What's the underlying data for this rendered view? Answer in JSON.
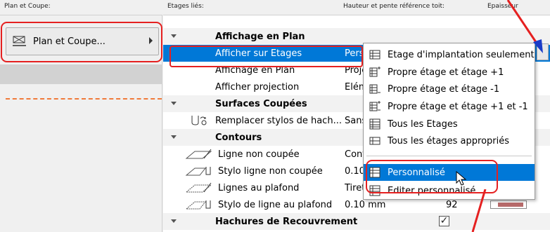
{
  "headers": {
    "plan_coupe": "Plan et Coupe:",
    "etages_lies": "Etages liés:",
    "hauteur": "Hauteur et pente référence toit:",
    "epaisseur": "Epaisseur"
  },
  "left": {
    "button_label": "Plan et Coupe..."
  },
  "rows": [
    {
      "type": "group",
      "name": "Affichage en Plan"
    },
    {
      "type": "sel",
      "name": "Afficher sur Etages",
      "value": "Perso"
    },
    {
      "type": "item",
      "name": "Affichage en Plan",
      "value": "Proje"
    },
    {
      "type": "item",
      "name": "Afficher projection",
      "value": "Elém"
    },
    {
      "type": "group",
      "name": "Surfaces Coupées"
    },
    {
      "type": "item",
      "name": "Remplacer stylos de hach...",
      "value": "Sans"
    },
    {
      "type": "group",
      "name": "Contours"
    },
    {
      "type": "item",
      "name": "Ligne non coupée",
      "value": "Cont"
    },
    {
      "type": "item",
      "name": "Stylo ligne non coupée",
      "value": "0.10"
    },
    {
      "type": "item",
      "name": "Lignes au plafond",
      "value": "Tireté"
    },
    {
      "type": "item",
      "name": "Stylo de ligne au plafond",
      "value": "0.10 mm",
      "extra": "92"
    },
    {
      "type": "group",
      "name": "Hachures de Recouvrement"
    }
  ],
  "menu": {
    "items": [
      "Etage d'implantation seulement",
      "Propre étage et étage +1",
      "Propre étage et étage -1",
      "Propre étage et étage +1 et -1",
      "Tous les Etages",
      "Tous les étages appropriés",
      "Personnalisé",
      "Editer personnalisé..."
    ]
  },
  "colors": {
    "selection": "#0078d7",
    "annotation_red": "#e52020"
  }
}
